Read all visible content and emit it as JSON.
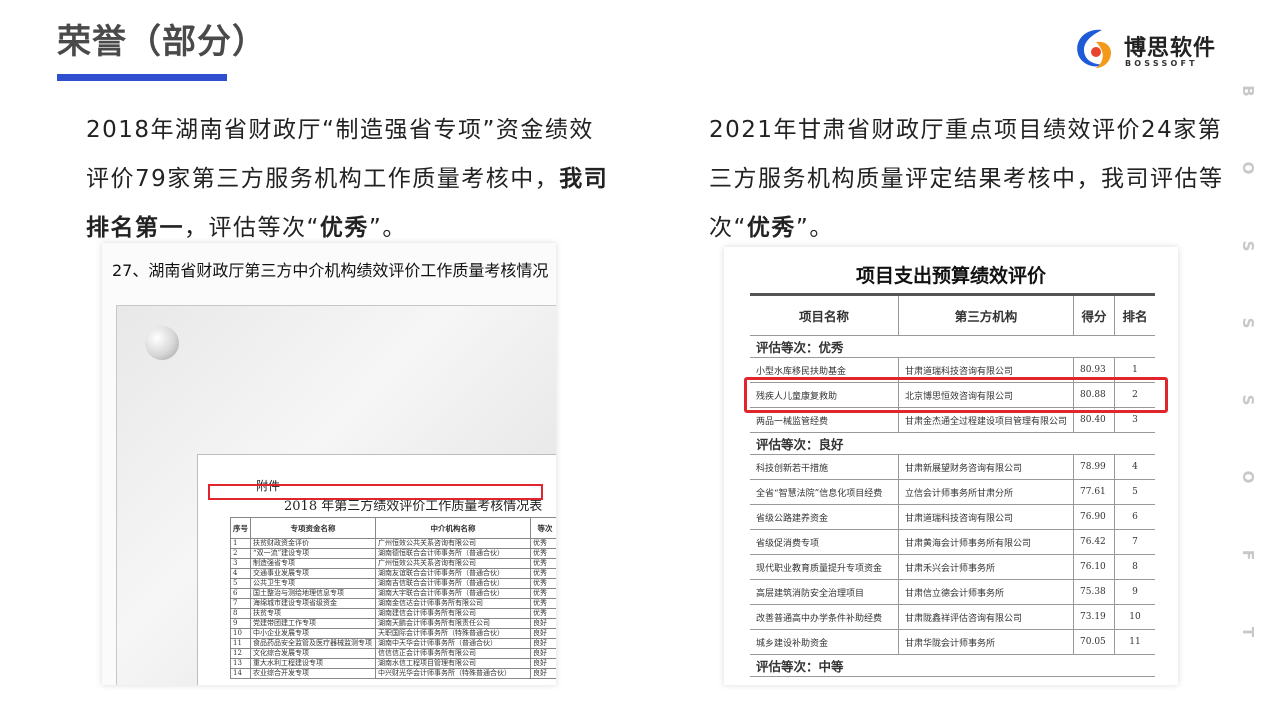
{
  "header": {
    "title": "荣誉（部分）",
    "logo_cn": "博思软件",
    "logo_en": "BOSSSOFT",
    "accent": "#2f4fcf"
  },
  "side_letters": [
    "B",
    "O",
    "S",
    "S",
    "S",
    "O",
    "F",
    "T"
  ],
  "left": {
    "paragraph_pre": "2018年湖南省财政厅“制造强省专项”资金绩效评价79家第三方服务机构工作质量考核中，",
    "paragraph_bold1": "我司排名第一",
    "paragraph_mid": "，评估等次“",
    "paragraph_bold2": "优秀",
    "paragraph_post": "”。",
    "image_caption": "27、湖南省财政厅第三方中介机构绩效评价工作质量考核情况",
    "doc_fujian": "附件",
    "doc_title": "2018 年第三方绩效评价工作质量考核情况表",
    "table_headers": [
      "序号",
      "专项资金名称",
      "中介机构名称",
      "等次"
    ],
    "table_rows": [
      [
        "1",
        "扶贫财政资金评价",
        "广州恒效公共关系咨询有限公司",
        "优秀"
      ],
      [
        "2",
        "“双一流”建设专项",
        "湖南德恒联合会计师事务所（普通合伙）",
        "优秀"
      ],
      [
        "3",
        "制造强省专项",
        "广州恒效公共关系咨询有限公司",
        "优秀"
      ],
      [
        "4",
        "交通事业发展专项",
        "湖南友谊联合会计师事务所（普通合伙）",
        "优秀"
      ],
      [
        "5",
        "公共卫生专项",
        "湖南吉信联合会计师事务所（普通合伙）",
        "优秀"
      ],
      [
        "6",
        "国土整治与测绘地理信息专项",
        "湖南大宇联合会计师事务所（普通合伙）",
        "优秀"
      ],
      [
        "7",
        "海绵城市建设专项省级资金",
        "湖南金信达会计师事务所有限公司",
        "优秀"
      ],
      [
        "8",
        "扶贫专项",
        "湖南建信会计师事务所有限公司",
        "优秀"
      ],
      [
        "9",
        "党建带团建工作专项",
        "湖南天鹏会计师事务所有限责任公司",
        "良好"
      ],
      [
        "10",
        "中小企业发展专项",
        "天职国际会计师事务所（特殊普通合伙）",
        "良好"
      ],
      [
        "11",
        "食品药品安全监管及医疗器械监测专项",
        "湖南中天华会计师事务所（普通合伙）",
        "良好"
      ],
      [
        "12",
        "文化综合发展专项",
        "信信信正会计师事务所有限公司",
        "良好"
      ],
      [
        "13",
        "重大水利工程建设专项",
        "湖南水信工程项目管理有限公司",
        "良好"
      ],
      [
        "14",
        "农业综合开发专项",
        "中兴财光华会计师事务所（特殊普通合伙）",
        "良好"
      ]
    ]
  },
  "right": {
    "paragraph_pre": "2021年甘肃省财政厅重点项目绩效评价24家第三方服务机构质量评定结果考核中，我司评估等次“",
    "paragraph_bold": "优秀",
    "paragraph_post": "”。",
    "image_title": "项目支出预算绩效评价",
    "table_headers": [
      "项目名称",
      "第三方机构",
      "得分",
      "排名"
    ],
    "sections": [
      {
        "label": "评估等次：优秀",
        "rows": [
          [
            "小型水库移民扶助基金",
            "甘肃道瑞科技咨询有限公司",
            "80.93",
            "1"
          ],
          [
            "残疾人儿童康复救助",
            "北京博思恒效咨询有限公司",
            "80.88",
            "2"
          ],
          [
            "两品一械监管经费",
            "甘肃金杰通全过程建设项目管理有限公司",
            "80.40",
            "3"
          ]
        ]
      },
      {
        "label": "评估等次：良好",
        "rows": [
          [
            "科技创新若干措施",
            "甘肃新展望财务咨询有限公司",
            "78.99",
            "4"
          ],
          [
            "全省“智慧法院”信息化项目经费",
            "立信会计师事务所甘肃分所",
            "77.61",
            "5"
          ],
          [
            "省级公路建养资金",
            "甘肃道瑞科技咨询有限公司",
            "76.90",
            "6"
          ],
          [
            "省级促消费专项",
            "甘肃黄海会计师事务所有限公司",
            "76.42",
            "7"
          ],
          [
            "现代职业教育质量提升专项资金",
            "甘肃禾兴会计师事务所",
            "76.10",
            "8"
          ],
          [
            "高层建筑消防安全治理项目",
            "甘肃信立德会计师事务所",
            "75.38",
            "9"
          ],
          [
            "改善普通高中办学条件补助经费",
            "甘肃陇鑫祥评估咨询有限公司",
            "73.19",
            "10"
          ],
          [
            "城乡建设补助资金",
            "甘肃华陇会计师事务所",
            "70.05",
            "11"
          ]
        ]
      },
      {
        "label": "评估等次：中等",
        "rows": []
      }
    ],
    "highlight_color": "#e0262c"
  }
}
